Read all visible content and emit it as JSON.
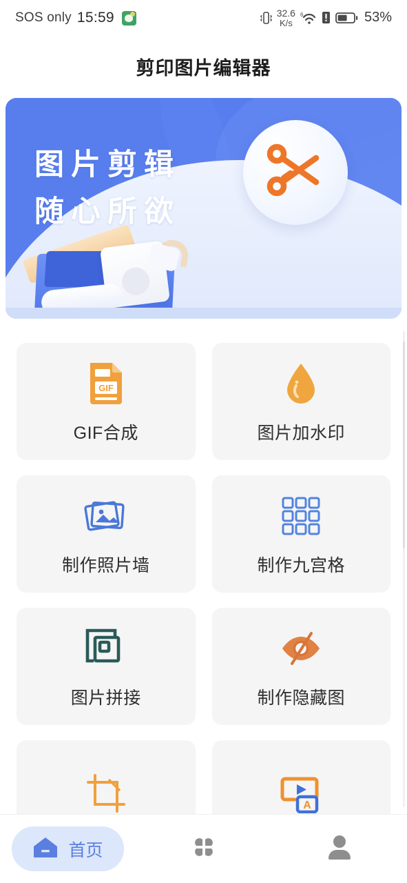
{
  "statusbar": {
    "carrier": "SOS only",
    "time": "15:59",
    "app_icon": "wechat-like-app-icon",
    "net_speed_value": "32.6",
    "net_speed_unit": "K/s",
    "vibrate_icon": "vibrate-icon",
    "wifi_icon": "wifi-icon",
    "wifi_badge": "6",
    "alert_icon": "sim-alert-icon",
    "battery_icon": "battery-icon",
    "battery_percent": "53%"
  },
  "header": {
    "title": "剪印图片编辑器"
  },
  "banner": {
    "line1": "图片剪辑",
    "line2": "随心所欲",
    "badge_icon": "scissors-icon",
    "illustration": "open-box-illustration",
    "bg_color": "#4b72e8",
    "accent_color": "#ee7628"
  },
  "features": [
    {
      "label": "GIF合成",
      "icon": "gif-file-icon",
      "color": "#f0a03c"
    },
    {
      "label": "图片加水印",
      "icon": "water-drop-icon",
      "color": "#efa63e"
    },
    {
      "label": "制作照片墙",
      "icon": "photo-stack-icon",
      "color": "#4a78d8"
    },
    {
      "label": "制作九宫格",
      "icon": "grid-3x3-icon",
      "color": "#5183e0"
    },
    {
      "label": "图片拼接",
      "icon": "overlap-squares-icon",
      "color": "#2b5a58"
    },
    {
      "label": "制作隐藏图",
      "icon": "eye-off-icon",
      "color": "#d9743a"
    },
    {
      "label": "",
      "icon": "crop-icon",
      "color": "#f0a03c"
    },
    {
      "label": "",
      "icon": "video-subtitle-icon",
      "color": "#f0902e"
    }
  ],
  "bottom_nav": [
    {
      "label": "首页",
      "icon": "home-icon",
      "active": true
    },
    {
      "label": "",
      "icon": "apps-grid-icon",
      "active": false
    },
    {
      "label": "",
      "icon": "person-icon",
      "active": false
    }
  ]
}
